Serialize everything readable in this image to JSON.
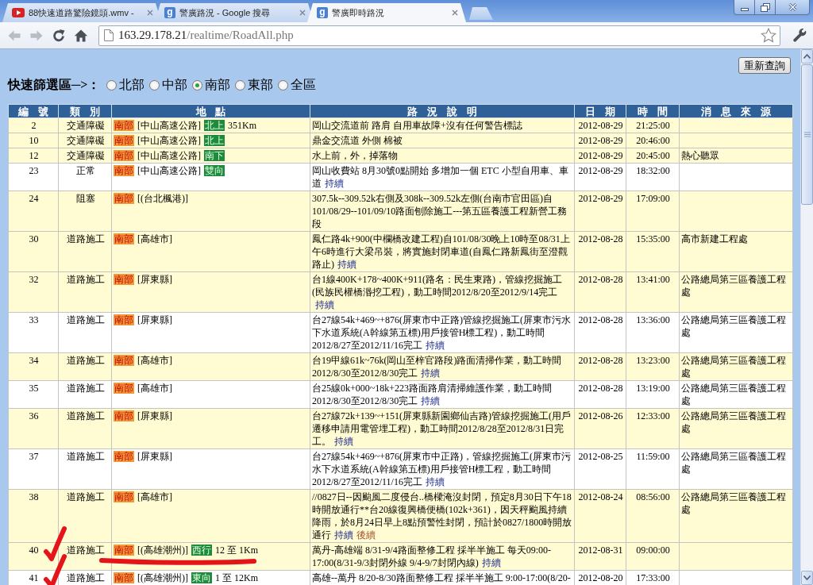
{
  "browser": {
    "tabs": [
      {
        "title": "88快速道路驚險鏡頭.wmv -",
        "favicon": {
          "kind": "play"
        },
        "selected": false
      },
      {
        "title": "警廣路況 - Google 搜尋",
        "favicon": {
          "kind": "letter",
          "letter": "g"
        },
        "selected": false
      },
      {
        "title": "警廣即時路況",
        "favicon": {
          "kind": "letter",
          "letter": "g"
        },
        "selected": true
      }
    ],
    "nav_buttons": [
      {
        "kind": "back",
        "disabled": true
      },
      {
        "kind": "forward",
        "disabled": true
      },
      {
        "kind": "reload",
        "disabled": false
      },
      {
        "kind": "home",
        "disabled": false
      }
    ],
    "address": {
      "host": "163.29.178.21",
      "path": "/realtime/RoadAll.php"
    }
  },
  "page": {
    "refresh_button": "重新查詢",
    "filter": {
      "label": "快速篩選區─>：",
      "options": [
        {
          "label": "北部",
          "selected": false
        },
        {
          "label": "中部",
          "selected": false
        },
        {
          "label": "南部",
          "selected": true
        },
        {
          "label": "東部",
          "selected": false
        },
        {
          "label": "全區",
          "selected": false
        }
      ]
    },
    "table": {
      "columns": [
        "編號",
        "類別",
        "地點",
        "路況說明",
        "日期",
        "時間",
        "消息來源"
      ],
      "rows": [
        {
          "number": "2",
          "type": "交通障礙",
          "location": {
            "region": "南部",
            "road": "[中山高速公路]",
            "direction": "北上",
            "distance": "351Km",
            "underline_mark": false
          },
          "description": {
            "text": "岡山交流道前 路肩 自用車故障+沒有任何警告標誌"
          },
          "date": "2012-08-29",
          "time": "21:25:00",
          "highlighted": true,
          "check_mark": false
        },
        {
          "number": "10",
          "type": "交通障礙",
          "location": {
            "region": "南部",
            "road": "[中山高速公路]",
            "direction": "北上",
            "underline_mark": false
          },
          "description": {
            "text": "鼎金交流道 外側 棉被"
          },
          "date": "2012-08-29",
          "time": "20:46:00",
          "highlighted": true,
          "check_mark": false
        },
        {
          "number": "12",
          "type": "交通障礙",
          "location": {
            "region": "南部",
            "road": "[中山高速公路]",
            "direction": "南下",
            "underline_mark": false
          },
          "description": {
            "text": "水上前，外，掉落物"
          },
          "date": "2012-08-29",
          "time": "20:45:00",
          "source": "熱心聽眾",
          "highlighted": true,
          "check_mark": false
        },
        {
          "number": "23",
          "type": "正常",
          "location": {
            "region": "南部",
            "road": "[中山高速公路]",
            "direction": "雙向",
            "underline_mark": false
          },
          "description": {
            "text": "岡山收費站 8月30號0點開始 多增加一個 ETC 小型自用車、車道",
            "links": [
              {
                "label": "持續",
                "visited": false
              }
            ]
          },
          "date": "2012-08-29",
          "time": "18:32:00",
          "highlighted": false,
          "check_mark": false
        },
        {
          "number": "24",
          "type": "阻塞",
          "location": {
            "region": "南部",
            "road": "[(台北楓港)]",
            "underline_mark": false
          },
          "description": {
            "text": "307.5k--309.52k右側及308k--309.52k左側(台南市官田區)自101/08/29--101/09/10路面刨除施工---第五區養護工程新營工務段"
          },
          "date": "2012-08-29",
          "time": "17:09:00",
          "highlighted": true,
          "check_mark": false
        },
        {
          "number": "30",
          "type": "道路施工",
          "location": {
            "region": "南部",
            "road": "[高雄市]",
            "underline_mark": false
          },
          "description": {
            "text": "鳳仁路4k+900(中欄橋改建工程)自101/08/30晚上10時至08/31上午6時進行大梁吊裝，將實施封閉車道(自鳳仁路新鳳街至澄觀路止)",
            "links": [
              {
                "label": "持續",
                "visited": false
              }
            ]
          },
          "date": "2012-08-28",
          "time": "15:35:00",
          "source": "高市新建工程處",
          "highlighted": true,
          "check_mark": false
        },
        {
          "number": "32",
          "type": "道路施工",
          "location": {
            "region": "南部",
            "road": "[屏東縣]",
            "underline_mark": false
          },
          "description": {
            "text": "台1線400K+178~400K+911(路名：民生東路)，管線挖掘施工(民族民權橋湣挖工程)，動工時間2012/8/20至2012/9/14完工",
            "links": [
              {
                "label": "持續",
                "visited": false
              }
            ]
          },
          "date": "2012-08-28",
          "time": "13:41:00",
          "source": "公路總局第三區養護工程處",
          "highlighted": true,
          "check_mark": false
        },
        {
          "number": "33",
          "type": "道路施工",
          "location": {
            "region": "南部",
            "road": "[屏東縣]",
            "underline_mark": false
          },
          "description": {
            "text": "台27線54k+469~+876(屏東市中正路)管線挖掘施工(屏東市污水下水道系統(A幹線第五標)用戶接管H標工程)，動工時間2012/8/27至2012/11/16完工",
            "links": [
              {
                "label": "持續",
                "visited": false
              }
            ]
          },
          "date": "2012-08-28",
          "time": "13:36:00",
          "source": "公路總局第三區養護工程處",
          "highlighted": false,
          "check_mark": false
        },
        {
          "number": "34",
          "type": "道路施工",
          "location": {
            "region": "南部",
            "road": "[高雄市]",
            "underline_mark": false
          },
          "description": {
            "text": "台19甲線61k~76k(岡山至梓官路段)路面清掃作業，動工時間2012/8/30至2012/8/30完工",
            "links": [
              {
                "label": "持續",
                "visited": false
              }
            ]
          },
          "date": "2012-08-28",
          "time": "13:23:00",
          "source": "公路總局第三區養護工程處",
          "highlighted": true,
          "check_mark": false
        },
        {
          "number": "35",
          "type": "道路施工",
          "location": {
            "region": "南部",
            "road": "[高雄市]",
            "underline_mark": false
          },
          "description": {
            "text": "台25線0k+000~18k+223路面路肩清掃維護作業，動工時間2012/8/30至2012/8/30完工",
            "links": [
              {
                "label": "持續",
                "visited": false
              }
            ]
          },
          "date": "2012-08-28",
          "time": "13:19:00",
          "source": "公路總局第三區養護工程處",
          "highlighted": false,
          "check_mark": false
        },
        {
          "number": "36",
          "type": "道路施工",
          "location": {
            "region": "南部",
            "road": "[屏東縣]",
            "underline_mark": false
          },
          "description": {
            "text": "台27線72k+139~+151(屏東縣新園鄉仙吉路)管線挖掘施工(用戶遷移申請用電管埋工程)，動工時間2012/8/28至2012/8/31日完工。",
            "links": [
              {
                "label": "持續",
                "visited": false
              }
            ]
          },
          "date": "2012-08-26",
          "time": "12:33:00",
          "source": "公路總局第三區養護工程處",
          "highlighted": true,
          "check_mark": false
        },
        {
          "number": "37",
          "type": "道路施工",
          "location": {
            "region": "南部",
            "road": "[屏東縣]",
            "underline_mark": false
          },
          "description": {
            "text": "台27線54k+469~+876(屏東市中正路)，管線挖掘施工(屏東市污水下水道系統(A幹線第五標)用戶接管H標工程，動工時間2012/8/27至2012/11/16完工",
            "links": [
              {
                "label": "持續",
                "visited": false
              }
            ]
          },
          "date": "2012-08-25",
          "time": "11:59:00",
          "source": "公路總局第三區養護工程處",
          "highlighted": false,
          "check_mark": false
        },
        {
          "number": "38",
          "type": "道路施工",
          "location": {
            "region": "南部",
            "road": "[高雄市]",
            "underline_mark": false
          },
          "description": {
            "text": "//0827日--因颱風二度侵台..橋樑淹沒封閉，預定8月30日下午18時開放通行**台20線復興橋便橋(102k+361)，因天秤颱風持續降雨，於8月24日早上8點預警性封閉，預計於0827/1800時開放通行",
            "links": [
              {
                "label": "持續",
                "visited": false
              },
              {
                "label": "後續",
                "visited": true
              }
            ]
          },
          "date": "2012-08-24",
          "time": "08:56:00",
          "source": "公路總局第三區養護工程處",
          "highlighted": true,
          "check_mark": false
        },
        {
          "number": "40",
          "type": "道路施工",
          "location": {
            "region": "南部",
            "road": "[(高雄潮州)]",
            "direction": "西行",
            "distance": "12 至 1Km",
            "underline_mark": true
          },
          "description": {
            "text": "萬丹-高雄端 8/31-9/4路面整修工程 採半半施工 每天09:00-17:00(8/31-9/3封閉外線 9/4-9/7封閉內線)",
            "links": [
              {
                "label": "持續",
                "visited": false
              }
            ]
          },
          "date": "2012-08-31",
          "time": "09:00:00",
          "highlighted": true,
          "check_mark": true
        },
        {
          "number": "41",
          "type": "道路施工",
          "location": {
            "region": "南部",
            "road": "[(高雄潮州)]",
            "direction": "東向",
            "distance": "1 至 12Km",
            "underline_mark": false
          },
          "description": {
            "text": "高雄--萬丹 8/20-8/30路面整修工程 採半半施工 9:00-17:00(8/20-"
          },
          "date": "2012-08-20",
          "time": "17:33:00",
          "highlighted": false,
          "check_mark": true
        }
      ]
    }
  }
}
